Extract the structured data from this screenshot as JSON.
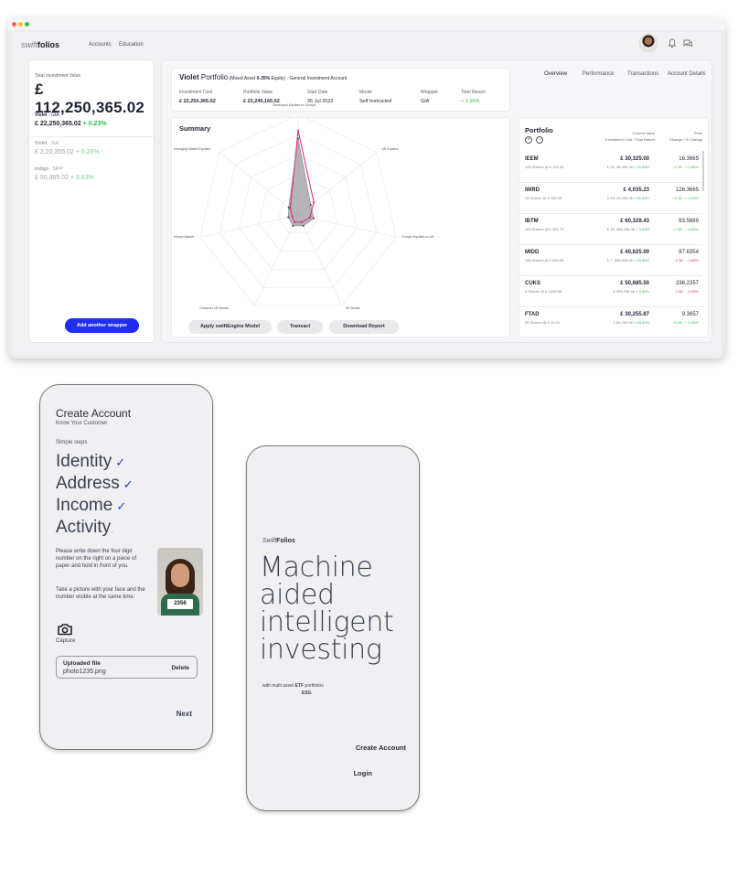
{
  "nav": {
    "logo_prefix": "swift",
    "logo_suffix": "folios",
    "links": [
      "Accounts",
      "Education"
    ]
  },
  "left_panel": {
    "total_label": "Total Investment Value",
    "total_value": "£ 112,250,365.02",
    "wrappers": [
      {
        "name": "Violet",
        "type": " - GIA",
        "value": "£ 22,250,365.02",
        "change": "+ 0.23%",
        "active": true
      },
      {
        "name": "Violet",
        "type": " - SIA",
        "value": "£ 2,20,355.02",
        "change": "+ 0.25%",
        "active": false
      },
      {
        "name": "Indigo",
        "type": " - SIPP",
        "value": "£ 50,365.02",
        "change": "+ 0.63%",
        "active": false
      }
    ],
    "add_button": "Add another wrapper"
  },
  "header": {
    "portfolio_name": "Violet",
    "portfolio_word": " Portfolio",
    "subtitle_pre": " (Mixed Asset ",
    "subtitle_bold": "0-35%",
    "subtitle_post": " Equity) - General Investment Account",
    "columns": [
      {
        "label": "Investment Cost",
        "value": "£ 22,250,365.02"
      },
      {
        "label": "Portfolio Value",
        "value": "£ 23,240,165.02"
      },
      {
        "label": "Start Date",
        "value": "26 Jul 2022"
      },
      {
        "label": "Model",
        "value": "Self Instructed"
      },
      {
        "label": "Wrapper",
        "value": "GIA"
      },
      {
        "label": "Total Return",
        "value": "+ 3.56%"
      }
    ]
  },
  "tabs": [
    "Overview",
    "Performance",
    "Transactions",
    "Account Details"
  ],
  "summary": {
    "title": "Summary",
    "buttons": [
      "Apply swiftEngine Model",
      "Transact",
      "Download Report"
    ]
  },
  "chart_data": {
    "type": "radar",
    "axes": [
      "Developed Equities ex Europe",
      "UK Equities",
      "Europe Equities ex UK",
      "UK Bonds",
      "Global ex UK Bonds",
      "Money Market",
      "Emerging Market Equities"
    ],
    "series": [
      {
        "values": [
          0.76,
          0.16,
          0.16,
          0.12,
          0.12,
          0.1,
          0.12
        ]
      },
      {
        "values": [
          0.84,
          0.2,
          0.12,
          0.08,
          0.08,
          0.06,
          0.1
        ]
      }
    ],
    "colors": [
      "#8a8a90",
      "#e0247c"
    ],
    "range": [
      0,
      1
    ]
  },
  "portfolio": {
    "title": "Portfolio",
    "col_value_header": "Current Value",
    "col_value_sub": "Investment Cost / Total Return",
    "col_price_header": "Price",
    "col_price_sub": "Change / % Change",
    "rows": [
      {
        "ticker": "IEEM",
        "shares": "135 Shares @ £ 159.35",
        "value": "£ 30,325.00",
        "cost": "£ 90, 36,256.36",
        "ret": "+ 25.83%",
        "price": "16.3665",
        "change": "+2.36 · + 2.65%",
        "dir": "up"
      },
      {
        "ticker": "IWRD",
        "shares": "15 Shares @ £ 289.65",
        "value": "£ 4,035.23",
        "cost": "£ 63, 25,256.36",
        "ret": "+ 50.83%",
        "price": "126.3665",
        "change": "+4.36 · + 3.25%",
        "dir": "up"
      },
      {
        "ticker": "IBTM",
        "shares": "165 Shares @ £ 369.75",
        "value": "£ 60,328.43",
        "cost": "£ 10, 366,256.36",
        "ret": "+ 3.83%",
        "price": "63.5689",
        "change": "+7.58 · + 6.65%",
        "dir": "up"
      },
      {
        "ticker": "MIDD",
        "shares": "185 Shares @ £ 639.65",
        "value": "£ 40,825.00",
        "cost": "£ 7, 586,636.36",
        "ret": "+ 93.85%",
        "price": "87.6354",
        "change": "-2.36 · - 2.65%",
        "dir": "down"
      },
      {
        "ticker": "CUKS",
        "shares": "5 Shares @ £ 1009.65",
        "value": "£ 50,685.50",
        "cost": "£ 366,256.36",
        "ret": "+ 8.85%",
        "price": "236.2357",
        "change": "-7.56 · - 6.05%",
        "dir": "down"
      },
      {
        "ticker": "FTAD",
        "shares": "65 Shares @ £ 19.25",
        "value": "£ 30,255.87",
        "cost": "£ 66,256.36",
        "ret": "+ 63.82%",
        "price": "9.3657",
        "change": "+8.96 · + 6.35%",
        "dir": "up"
      }
    ]
  },
  "kyc_phone": {
    "title": "Create Account",
    "subtitle": "Know Your Customer",
    "steps_label": "Simple steps",
    "steps": [
      {
        "label": "Identity",
        "done": true
      },
      {
        "label": "Address",
        "done": true
      },
      {
        "label": "Income",
        "done": true
      },
      {
        "label": "Activity",
        "done": false
      }
    ],
    "instructions_1": "Please write down the four digit number on the right on a piece of paper and hold in front of you.",
    "instructions_2": "Take a picture with your face and the number visible at the same time.",
    "paper_number": "2356",
    "capture_label": "Capture",
    "upload_title": "Uploaded file",
    "upload_file": "photo1235.png",
    "delete_label": "Delete",
    "next_label": "Next"
  },
  "landing_phone": {
    "logo_prefix": "Swift",
    "logo_suffix": "Folios",
    "hero_lines": [
      "Machine",
      "aided",
      "intelligent",
      "investing"
    ],
    "tagline_pre": "with multi asset ",
    "tagline_etf": "ETF",
    "tagline_post": " portfolios",
    "tagline_esg": "ESG",
    "create_account": "Create Account",
    "login": "Login"
  }
}
